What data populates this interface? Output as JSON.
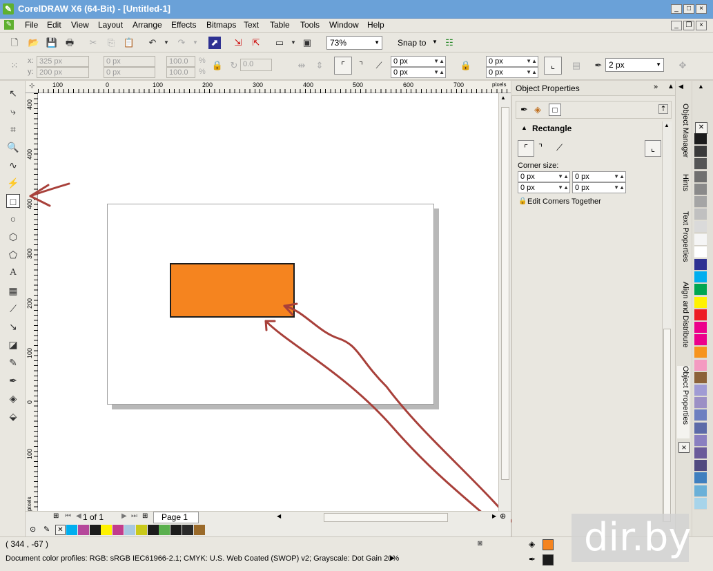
{
  "window": {
    "title": "CorelDRAW X6 (64-Bit) - [Untitled-1]"
  },
  "menu": [
    "File",
    "Edit",
    "View",
    "Layout",
    "Arrange",
    "Effects",
    "Bitmaps",
    "Text",
    "Table",
    "Tools",
    "Window",
    "Help"
  ],
  "toolbar": {
    "zoom": "73%",
    "snap_label": "Snap to"
  },
  "property_bar": {
    "x_label": "x:",
    "y_label": "y:",
    "x_value": "325 px",
    "y_value": "200 px",
    "w_value": "0 px",
    "h_value": "0 px",
    "scale_w": "100.0",
    "scale_h": "100.0",
    "pct": "%",
    "angle": "0.0",
    "corner_tl": "0 px",
    "corner_bl": "0 px",
    "corner_tr": "0 px",
    "corner_br": "0 px",
    "outline_width": "2 px"
  },
  "ruler": {
    "top": [
      "100",
      "0",
      "100",
      "200",
      "300",
      "400",
      "500",
      "600",
      "700"
    ],
    "unit": "pixels",
    "left": [
      "400",
      "300",
      "200",
      "100",
      "0",
      "100"
    ]
  },
  "docker": {
    "title": "Object Properties",
    "section": "Rectangle",
    "corner_size_label": "Corner size:",
    "c1": "0 px",
    "c2": "0 px",
    "c3": "0 px",
    "c4": "0 px",
    "edit_together": "Edit Corners Together",
    "tabs": [
      "Object Manager",
      "Hints",
      "Text Properties",
      "Align and Distribute",
      "Object Properties"
    ]
  },
  "page_nav": {
    "counter": "1 of 1",
    "tab": "Page 1"
  },
  "status": {
    "coords": "( 344 , -67 )",
    "profiles": "Document color profiles: RGB: sRGB IEC61966-2.1; CMYK: U.S. Web Coated (SWOP) v2; Grayscale: Dot Gain 20%"
  },
  "watermark": "dir.by",
  "colors": {
    "fill": "#f5841f",
    "outline": "#1c1c1c",
    "palette": [
      "#ffffff",
      "#1c1c1c",
      "#3a3a3a",
      "#555555",
      "#707070",
      "#8a8a8a",
      "#a5a5a5",
      "#c0c0c0",
      "#dadada",
      "#f5f5f5",
      "#ffffff",
      "#2e3192",
      "#00aeef",
      "#00a651",
      "#fff200",
      "#ed1c24",
      "#ec008c",
      "#ec008c",
      "#f7941d",
      "#f49ac1",
      "#8c6239",
      "#a09bd4",
      "#9b8fc5",
      "#6d7fc0",
      "#5c6aa8",
      "#8a7fc0",
      "#6a5a9a",
      "#514a80",
      "#3f7fbf",
      "#6ab0d8",
      "#a7d4ea"
    ],
    "doc_palette": [
      "#00aeef",
      "#b5489b",
      "#1c1c1c",
      "#fff200",
      "#c23c8c",
      "#a8c8e0",
      "#c9c91a",
      "#1c1c1c",
      "#5ab04e",
      "#1c1c1c",
      "#2a2a2a",
      "#9a6a2a"
    ]
  }
}
